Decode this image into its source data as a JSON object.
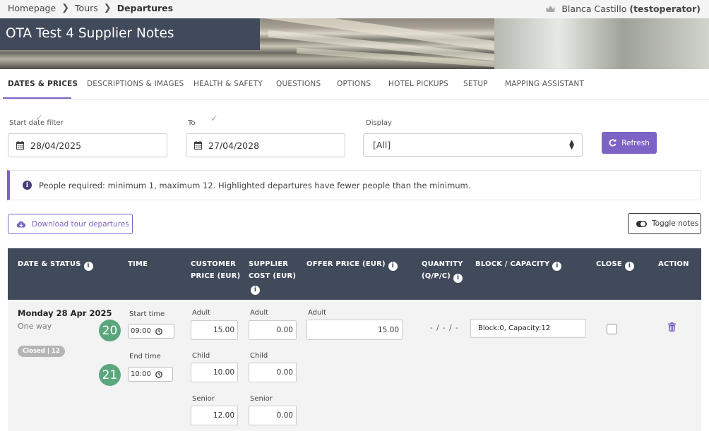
{
  "breadcrumb": {
    "home": "Homepage",
    "tours": "Tours",
    "current": "Departures"
  },
  "user": {
    "name": "Blanca Castillo",
    "username": "(testoperator)",
    "crown_icon": "crown-icon"
  },
  "banner": {
    "title": "OTA Test 4 Supplier Notes"
  },
  "tabs": [
    {
      "label": "DATES & PRICES",
      "active": true
    },
    {
      "label": "DESCRIPTIONS & IMAGES"
    },
    {
      "label": "HEALTH & SAFETY"
    },
    {
      "label": "QUESTIONS"
    },
    {
      "label": "OPTIONS"
    },
    {
      "label": "HOTEL PICKUPS"
    },
    {
      "label": "SETUP"
    },
    {
      "label": "MAPPING ASSISTANT"
    }
  ],
  "filters": {
    "start_label": "Start date filter",
    "start_value": "28/04/2025",
    "to_label": "To",
    "to_value": "27/04/2028",
    "display_label": "Display",
    "display_value": "[All]",
    "refresh_label": "Refresh"
  },
  "info": {
    "text": "People required: minimum 1, maximum 12. Highlighted departures have fewer people than the minimum."
  },
  "actions": {
    "download_label": "Download tour departures",
    "toggle_label": "Toggle notes"
  },
  "table": {
    "headers": {
      "date_status": "DATE & STATUS",
      "time": "TIME",
      "customer_price_1": "CUSTOMER",
      "customer_price_2": "PRICE (EUR)",
      "supplier_cost_1": "SUPPLIER",
      "supplier_cost_2": "COST (EUR)",
      "offer_price": "OFFER PRICE (EUR)",
      "quantity_1": "QUANTITY",
      "quantity_2": "(Q/P/C)",
      "block_capacity": "BLOCK / CAPACITY",
      "close": "CLOSE",
      "action": "ACTION"
    },
    "row": {
      "date": "Monday 28 Apr 2025",
      "trip": "One way",
      "status": "Closed | 12",
      "marker_start": "20",
      "marker_end": "21",
      "start_time_label": "Start time",
      "start_time": "09:00",
      "end_time_label": "End time",
      "end_time": "10:00",
      "customer": [
        {
          "label": "Adult",
          "value": "15.00"
        },
        {
          "label": "Child",
          "value": "10.00"
        },
        {
          "label": "Senior",
          "value": "12.00"
        }
      ],
      "supplier": [
        {
          "label": "Adult",
          "value": "0.00"
        },
        {
          "label": "Child",
          "value": "0.00"
        },
        {
          "label": "Senior",
          "value": "0.00"
        }
      ],
      "offer": {
        "label": "Adult",
        "value": "15.00"
      },
      "quantity": "- / - / -",
      "block_capacity": "Block:0, Capacity:12"
    }
  },
  "colors": {
    "accent": "#7d63c6",
    "header_bg": "#414a5b",
    "marker": "#5aa77c"
  }
}
